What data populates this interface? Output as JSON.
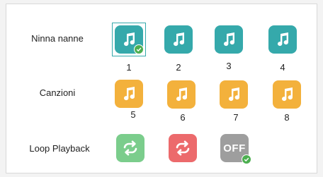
{
  "rows": {
    "lullabies": {
      "label": "Ninna nanne",
      "items": [
        {
          "number": "1",
          "icon": "music-note-icon",
          "selected": true
        },
        {
          "number": "2",
          "icon": "music-note-icon",
          "selected": false
        },
        {
          "number": "3",
          "icon": "music-note-icon",
          "selected": false
        },
        {
          "number": "4",
          "icon": "music-note-icon",
          "selected": false
        }
      ]
    },
    "songs": {
      "label": "Canzioni",
      "items": [
        {
          "number": "5",
          "icon": "music-note-icon",
          "selected": false
        },
        {
          "number": "6",
          "icon": "music-note-icon",
          "selected": false
        },
        {
          "number": "7",
          "icon": "music-note-icon",
          "selected": false
        },
        {
          "number": "8",
          "icon": "music-note-icon",
          "selected": false
        }
      ]
    },
    "loop": {
      "label": "Loop Playback",
      "options": [
        {
          "icon": "loop-icon",
          "color": "#7bcd8c",
          "selected": false
        },
        {
          "icon": "loop-icon",
          "color": "#ec6a6c",
          "selected": false
        },
        {
          "icon": "off-icon",
          "text": "OFF",
          "color": "#9e9e9e",
          "selected": true
        }
      ]
    }
  },
  "colors": {
    "lullaby_tile": "#35a9ab",
    "song_tile": "#f3b13c",
    "check_badge": "#4caf50"
  }
}
